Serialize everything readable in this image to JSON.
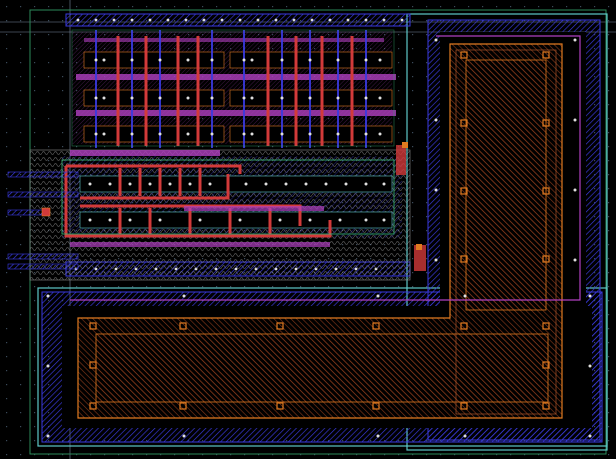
{
  "viewer": {
    "background": "#000000",
    "grid_dot_color": "#3a4a5a"
  },
  "layers": {
    "nwell": {
      "color": "#2d8a8a"
    },
    "diff": {
      "color": "#5a6fe0"
    },
    "poly": {
      "color": "#d23a3a"
    },
    "metal1": {
      "color": "#3a3ae0"
    },
    "metal2": {
      "color": "#b040c0"
    },
    "ptap": {
      "color": "#e07a20"
    },
    "contact": {
      "color": "#e0e0e0"
    },
    "hatch": {
      "color": "#a0a0a0"
    },
    "outline": {
      "color": "#5ec8c8"
    }
  },
  "icons": [
    "contact-icon",
    "via-icon"
  ]
}
